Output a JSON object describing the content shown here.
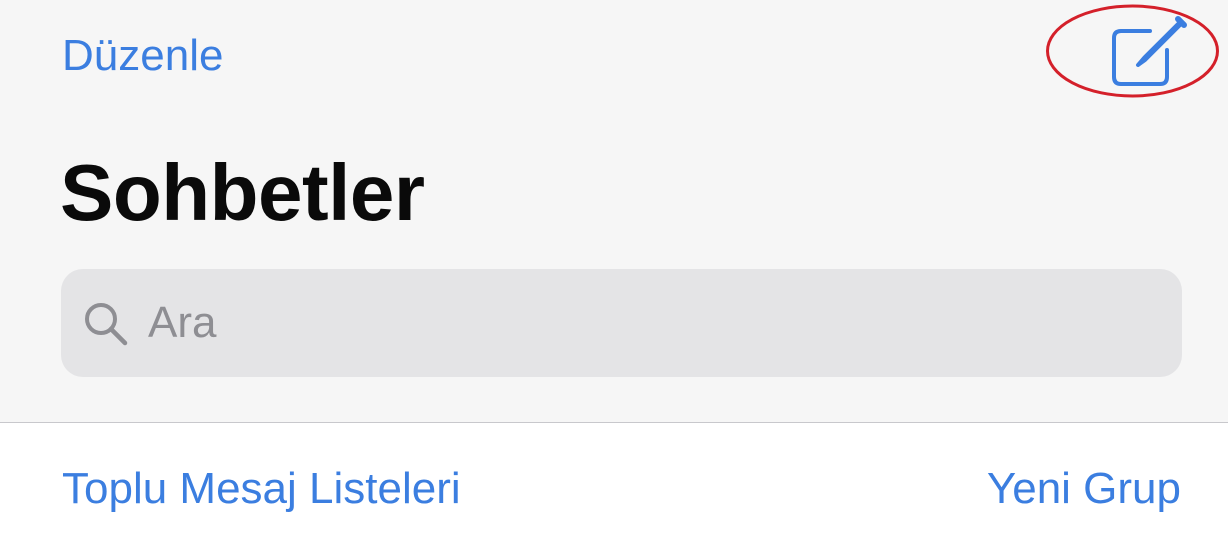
{
  "header": {
    "edit_label": "Düzenle",
    "title": "Sohbetler"
  },
  "search": {
    "placeholder": "Ara"
  },
  "actions": {
    "broadcast_lists": "Toplu Mesaj Listeleri",
    "new_group": "Yeni Grup"
  },
  "icons": {
    "compose": "compose-icon",
    "search": "search-icon"
  },
  "colors": {
    "accent": "#3b7ee0",
    "highlight_circle": "#d4202a",
    "header_background": "#f6f6f6",
    "search_background": "#e4e4e6",
    "title": "#0a0a0a",
    "placeholder": "#8e8e93"
  }
}
